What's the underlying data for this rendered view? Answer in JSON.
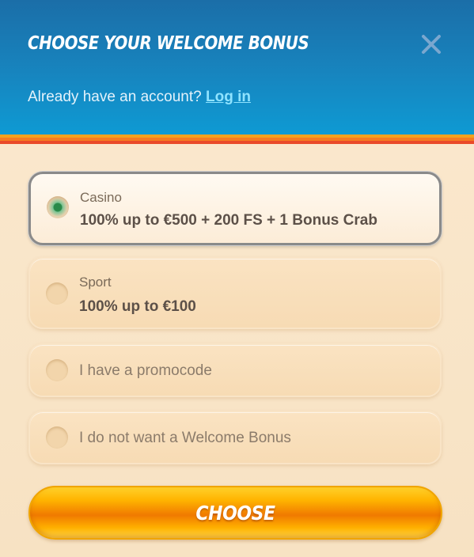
{
  "header": {
    "title": "CHOOSE YOUR WELCOME BONUS",
    "close_icon": "close-icon",
    "account_prompt": "Already have an account?",
    "login_link": "Log in"
  },
  "options": [
    {
      "label": "Casino",
      "value": "100% up to €500 + 200 FS + 1 Bonus Crab",
      "selected": true
    },
    {
      "label": "Sport",
      "value": "100% up to €100",
      "selected": false
    },
    {
      "label": "I have a promocode",
      "selected": false
    },
    {
      "label": "I do not want a Welcome Bonus",
      "selected": false
    }
  ],
  "choose_button": {
    "label": "CHOOSE"
  },
  "colors": {
    "header_top": "#1b6ea8",
    "header_bottom": "#0e9ad3",
    "accent_orange": "#f4a21c",
    "link": "#8fe3ff",
    "button_orange": "#f07a00"
  }
}
